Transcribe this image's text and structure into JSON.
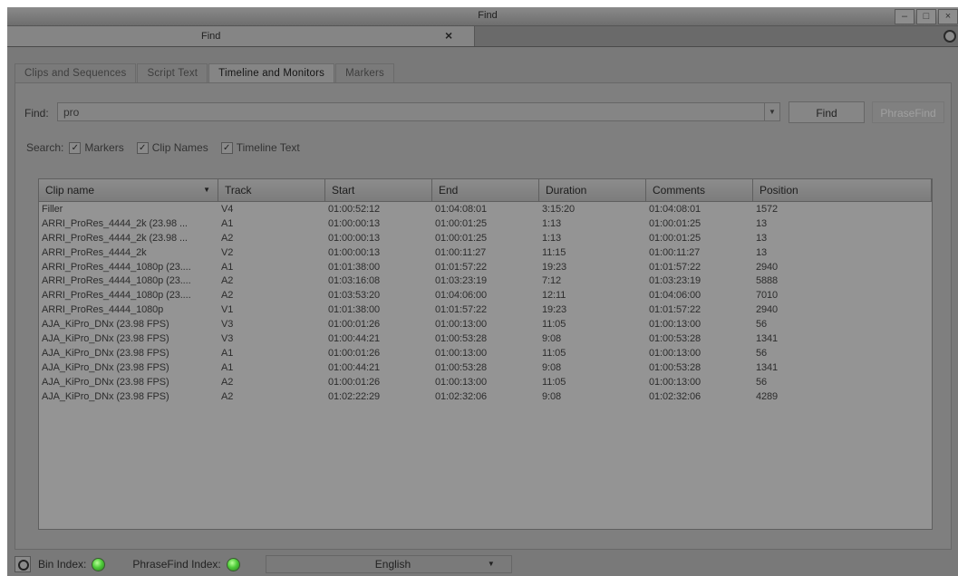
{
  "window": {
    "title": "Find",
    "buttons": [
      "–",
      "□",
      "×"
    ]
  },
  "doc_tab": {
    "label": "Find",
    "close": "×"
  },
  "tabs": [
    {
      "label": "Clips and Sequences",
      "active": false
    },
    {
      "label": "Script Text",
      "active": false
    },
    {
      "label": "Timeline and Monitors",
      "active": true
    },
    {
      "label": "Markers",
      "active": false
    }
  ],
  "find": {
    "label": "Find:",
    "value": "pro",
    "find_button": "Find",
    "phrasefind_button": "PhraseFind"
  },
  "search": {
    "label": "Search:",
    "options": [
      {
        "label": "Markers",
        "checked": true
      },
      {
        "label": "Clip Names",
        "checked": true
      },
      {
        "label": "Timeline Text",
        "checked": true
      }
    ]
  },
  "table": {
    "columns": [
      "Clip name",
      "Track",
      "Start",
      "End",
      "Duration",
      "Comments",
      "Position"
    ],
    "rows": [
      [
        "Filler",
        "V4",
        "01:00:52:12",
        "01:04:08:01",
        "3:15:20",
        "01:04:08:01",
        "1572"
      ],
      [
        "ARRI_ProRes_4444_2k (23.98 ...",
        "A1",
        "01:00:00:13",
        "01:00:01:25",
        "1:13",
        "01:00:01:25",
        "13"
      ],
      [
        "ARRI_ProRes_4444_2k (23.98 ...",
        "A2",
        "01:00:00:13",
        "01:00:01:25",
        "1:13",
        "01:00:01:25",
        "13"
      ],
      [
        "ARRI_ProRes_4444_2k",
        "V2",
        "01:00:00:13",
        "01:00:11:27",
        "11:15",
        "01:00:11:27",
        "13"
      ],
      [
        "ARRI_ProRes_4444_1080p (23....",
        "A1",
        "01:01:38:00",
        "01:01:57:22",
        "19:23",
        "01:01:57:22",
        "2940"
      ],
      [
        "ARRI_ProRes_4444_1080p (23....",
        "A2",
        "01:03:16:08",
        "01:03:23:19",
        "7:12",
        "01:03:23:19",
        "5888"
      ],
      [
        "ARRI_ProRes_4444_1080p (23....",
        "A2",
        "01:03:53:20",
        "01:04:06:00",
        "12:11",
        "01:04:06:00",
        "7010"
      ],
      [
        "ARRI_ProRes_4444_1080p",
        "V1",
        "01:01:38:00",
        "01:01:57:22",
        "19:23",
        "01:01:57:22",
        "2940"
      ],
      [
        "AJA_KiPro_DNx (23.98 FPS)",
        "V3",
        "01:00:01:26",
        "01:00:13:00",
        "11:05",
        "01:00:13:00",
        "56"
      ],
      [
        "AJA_KiPro_DNx (23.98 FPS)",
        "V3",
        "01:00:44:21",
        "01:00:53:28",
        "9:08",
        "01:00:53:28",
        "1341"
      ],
      [
        "AJA_KiPro_DNx (23.98 FPS)",
        "A1",
        "01:00:01:26",
        "01:00:13:00",
        "11:05",
        "01:00:13:00",
        "56"
      ],
      [
        "AJA_KiPro_DNx (23.98 FPS)",
        "A1",
        "01:00:44:21",
        "01:00:53:28",
        "9:08",
        "01:00:53:28",
        "1341"
      ],
      [
        "AJA_KiPro_DNx (23.98 FPS)",
        "A2",
        "01:00:01:26",
        "01:00:13:00",
        "11:05",
        "01:00:13:00",
        "56"
      ],
      [
        "AJA_KiPro_DNx (23.98 FPS)",
        "A2",
        "01:02:22:29",
        "01:02:32:06",
        "9:08",
        "01:02:32:06",
        "4289"
      ]
    ]
  },
  "status": {
    "bin_index_label": "Bin Index:",
    "phrasefind_index_label": "PhraseFind Index:",
    "language": "English"
  },
  "icons": {
    "settings": "gear-icon",
    "status_led": "green-led-icon",
    "dropdown": "chevron-down-icon",
    "sort": "sort-down-icon"
  }
}
